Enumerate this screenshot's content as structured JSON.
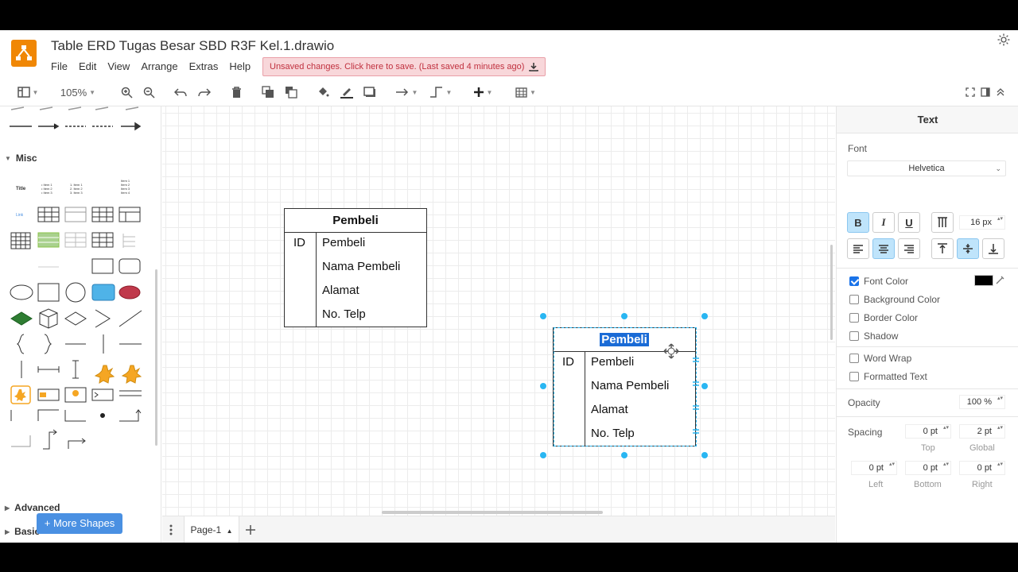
{
  "app": {
    "title": "Table ERD Tugas Besar SBD R3F Kel.1.drawio",
    "menu": [
      "File",
      "Edit",
      "View",
      "Arrange",
      "Extras",
      "Help"
    ],
    "unsaved_notice": "Unsaved changes. Click here to save. (Last saved 4 minutes ago)"
  },
  "toolbar": {
    "zoom": "105%"
  },
  "left_panel": {
    "section_misc": "Misc",
    "section_advanced": "Advanced",
    "section_basic": "Basic",
    "more_shapes": "+ More Shapes"
  },
  "canvas": {
    "tables": [
      {
        "title": "Pembeli",
        "key": "ID",
        "fields": [
          "Pembeli",
          "Nama Pembeli",
          "Alamat",
          "No. Telp"
        ]
      },
      {
        "title": "Pembeli",
        "key": "ID",
        "fields": [
          "Pembeli",
          "Nama Pembeli",
          "Alamat",
          "No. Telp"
        ]
      }
    ]
  },
  "pages": {
    "current": "Page-1"
  },
  "format_panel": {
    "tab": "Text",
    "font_label": "Font",
    "font_family": "Helvetica",
    "bold": "B",
    "italic": "I",
    "underline": "U",
    "font_size": "16 px",
    "font_color_label": "Font Color",
    "font_color": "#000000",
    "background_color_label": "Background Color",
    "border_color_label": "Border Color",
    "shadow_label": "Shadow",
    "word_wrap_label": "Word Wrap",
    "formatted_text_label": "Formatted Text",
    "opacity_label": "Opacity",
    "opacity_value": "100 %",
    "spacing_label": "Spacing",
    "spacing_top": "0 pt",
    "spacing_global": "2 pt",
    "spacing_left": "0 pt",
    "spacing_bottom": "0 pt",
    "spacing_right": "0 pt",
    "top_label": "Top",
    "global_label": "Global",
    "left_label": "Left",
    "bottom_label": "Bottom",
    "right_label": "Right"
  },
  "colors": {
    "accent": "#29b6f2",
    "logo": "#f08705",
    "warning_bg": "#f8d7da",
    "primary_button": "#4a90e2"
  }
}
